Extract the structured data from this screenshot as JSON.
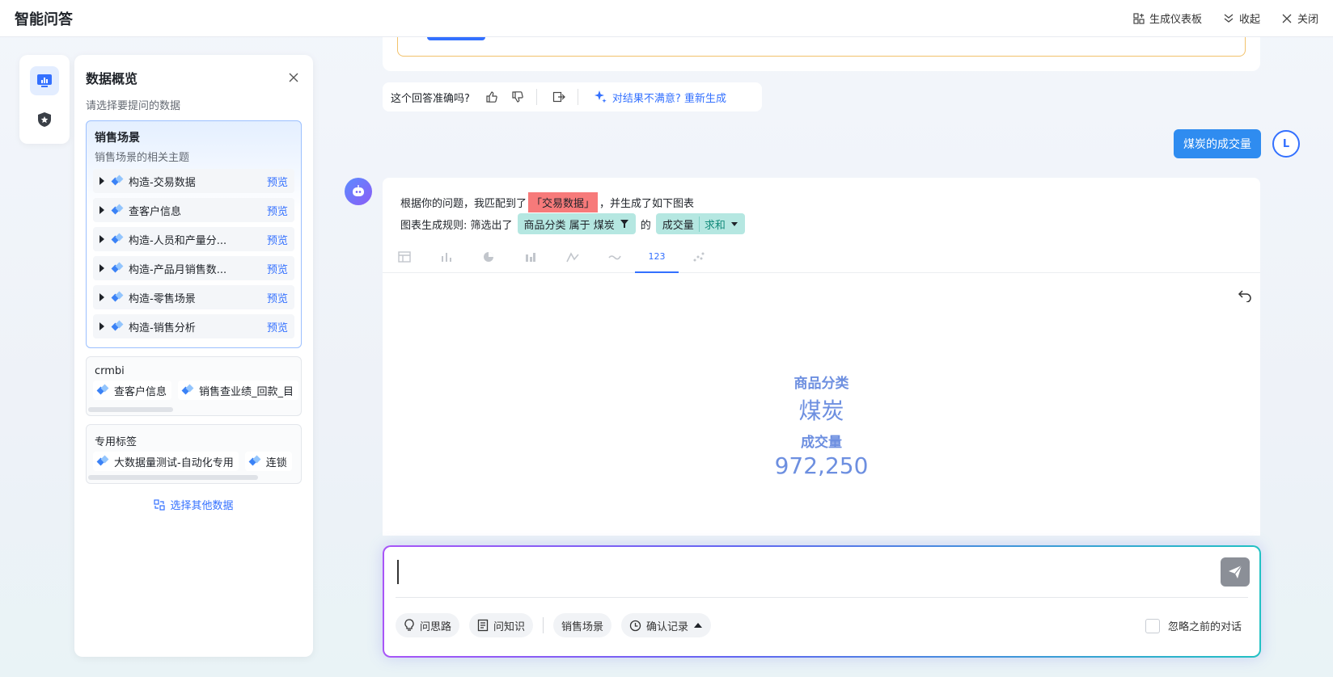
{
  "header": {
    "title": "智能问答",
    "actions": {
      "dashboard": "生成仪表板",
      "collapse": "收起",
      "close": "关闭"
    }
  },
  "panel": {
    "title": "数据概览",
    "subtitle": "请选择要提问的数据",
    "active_group": {
      "title": "销售场景",
      "desc": "销售场景的相关主题",
      "preview_label": "预览",
      "items": [
        "构造-交易数据",
        "查客户信息",
        "构造-人员和产量分...",
        "构造-产品月销售数...",
        "构造-零售场景",
        "构造-销售分析"
      ]
    },
    "group2": {
      "title": "crmbi",
      "chips": [
        "查客户信息",
        "销售查业绩_回款_目"
      ]
    },
    "group3": {
      "title": "专用标签",
      "chips": [
        "大数据量测试-自动化专用",
        "连锁"
      ]
    },
    "select_other": "选择其他数据"
  },
  "feedback": {
    "question": "这个回答准确吗?",
    "regenerate": "对结果不满意? 重新生成"
  },
  "user_message": {
    "text": "煤炭的成交量",
    "avatar_letter": "L"
  },
  "answer": {
    "line1_prefix": "根据你的问题，我匹配到了",
    "matched": "「交易数据」",
    "line1_suffix": "，并生成了如下图表",
    "rule_prefix": "图表生成规则: 筛选出了",
    "filter_chip": "商品分类 属于 煤炭",
    "of": "的",
    "measure": "成交量",
    "agg": "求和",
    "tab_number_label": "123",
    "kpi": {
      "dimension_label": "商品分类",
      "dimension_value": "煤炭",
      "measure_label": "成交量",
      "measure_value": "972,250"
    }
  },
  "input": {
    "placeholder": "",
    "tools": {
      "thinking": "问思路",
      "knowledge": "问知识",
      "scene": "销售场景",
      "records": "确认记录"
    },
    "ignore_label": "忽略之前的对话"
  }
}
